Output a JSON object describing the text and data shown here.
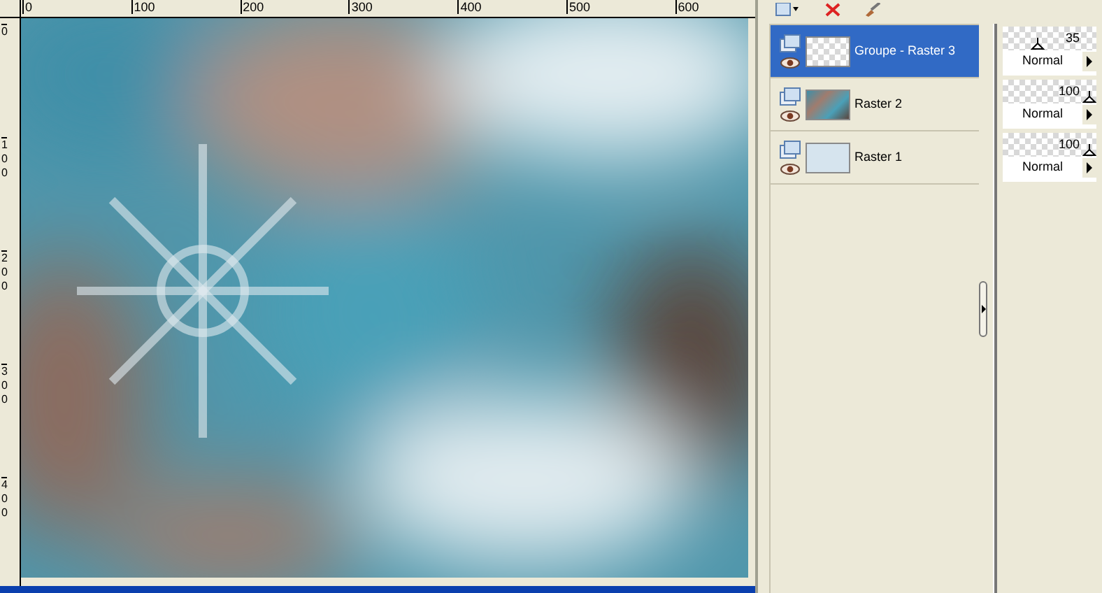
{
  "ruler_top": {
    "labels": [
      "0",
      "100",
      "200",
      "300",
      "400",
      "500",
      "600"
    ]
  },
  "ruler_left": {
    "labels": [
      "0",
      "100",
      "200",
      "300",
      "400"
    ]
  },
  "layers": [
    {
      "name": "Groupe - Raster 3",
      "selected": true,
      "kind": "checker",
      "opacity": "35",
      "level": 0.35,
      "blend": "Normal"
    },
    {
      "name": "Raster 2",
      "selected": false,
      "opacity": "100",
      "level": 1,
      "blend": "Normal"
    },
    {
      "name": "Raster 1",
      "selected": false,
      "kind": "plain",
      "opacity": "100",
      "level": 1,
      "blend": "Normal"
    }
  ]
}
